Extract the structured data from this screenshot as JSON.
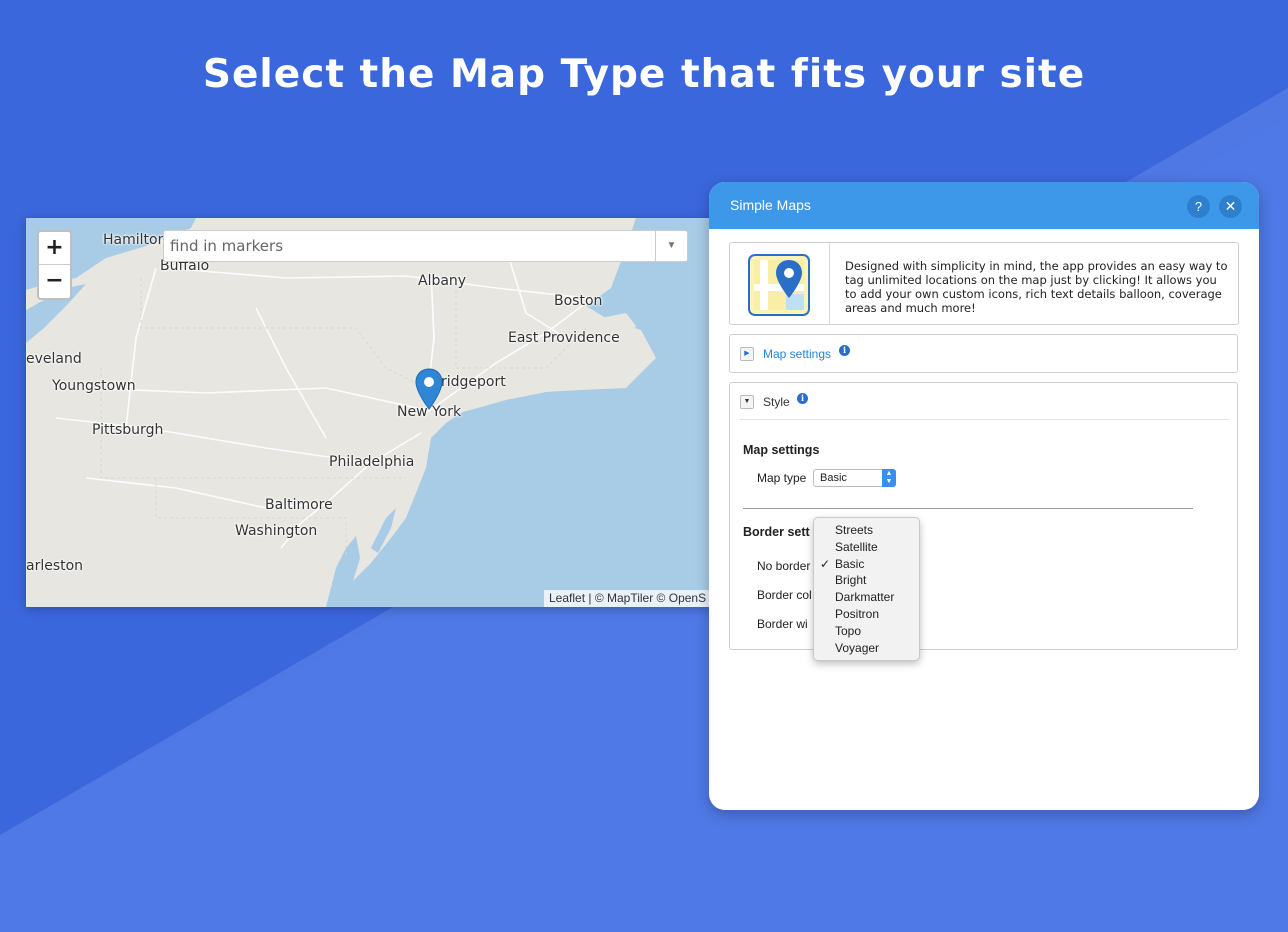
{
  "headline": "Select the Map Type that fits your site",
  "colors": {
    "background": "#4f78e4",
    "panel_header": "#3e98e9",
    "marker": "#2f86d6",
    "water": "#a8cbe6",
    "land": "#e7e6e1"
  },
  "map": {
    "zoom_in": "+",
    "zoom_out": "−",
    "search_placeholder": "find in markers",
    "search_dropdown_icon": "caret-down-icon",
    "attribution": "Leaflet | © MapTiler © OpenS",
    "marker_icon": "map-pin-icon",
    "labels": {
      "hamilton": "Hamilton",
      "buffalo": "Buffalo",
      "albany": "Albany",
      "boston": "Boston",
      "east_providence": "East Providence",
      "cleveland": "eveland",
      "youngstown": "Youngstown",
      "bridgeport": "ridgeport",
      "new_york": "New York",
      "pittsburgh": "Pittsburgh",
      "philadelphia": "Philadelphia",
      "baltimore": "Baltimore",
      "washington": "Washington",
      "charleston": "arleston"
    }
  },
  "panel": {
    "title": "Simple Maps",
    "help_label": "?",
    "close_label": "✕",
    "app_icon": "map-app-icon",
    "description": "Designed with simplicity in mind, the app provides an easy way to tag unlimited locations on the map just by clicking! It allows you to add your own custom icons, rich text details balloon, coverage areas and much more!",
    "sections": {
      "map_settings": {
        "title": "Map settings",
        "toggle": "▶",
        "info": "i"
      },
      "style": {
        "title": "Style",
        "toggle": "▼",
        "info": "i"
      }
    },
    "style": {
      "map_settings_heading": "Map settings",
      "map_type_label": "Map type",
      "map_type_value": "Basic",
      "border_heading": "Border sett",
      "no_border_label": "No border",
      "border_color_label": "Border col",
      "border_width_label": "Border wi"
    }
  },
  "dropdown": {
    "selected": "Basic",
    "check_mark": "✓",
    "options": [
      "Streets",
      "Satellite",
      "Basic",
      "Bright",
      "Darkmatter",
      "Positron",
      "Topo",
      "Voyager"
    ]
  }
}
